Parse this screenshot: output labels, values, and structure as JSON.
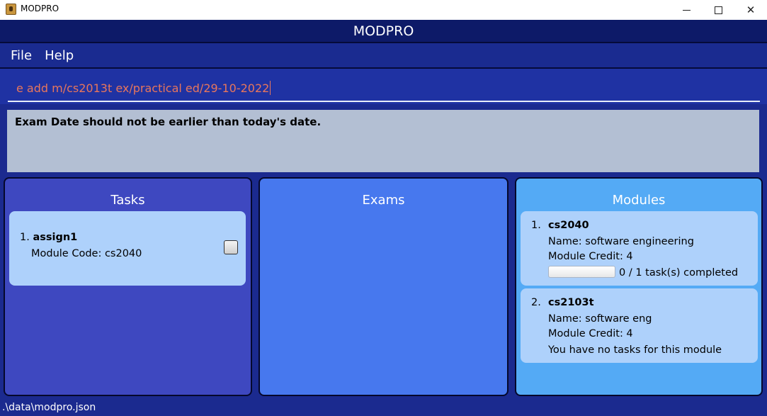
{
  "window": {
    "title": "MODPRO",
    "minimize_label": "",
    "maximize_label": "",
    "close_label": "✕"
  },
  "header": {
    "title": "MODPRO"
  },
  "menu": {
    "items": [
      "File",
      "Help"
    ]
  },
  "command": {
    "value": "e add m/cs2013t ex/practical ed/29-10-2022"
  },
  "result": {
    "message": "Exam Date should not be earlier than today's date."
  },
  "tasks": {
    "title": "Tasks",
    "items": [
      {
        "index": "1.",
        "name": "assign1",
        "module": "Module Code: cs2040",
        "done": false
      }
    ]
  },
  "exams": {
    "title": "Exams",
    "items": []
  },
  "modules": {
    "title": "Modules",
    "items": [
      {
        "index": "1.",
        "code": "cs2040",
        "name": "Name: software engineering",
        "credit": "Module Credit: 4",
        "progress": 0,
        "progress_text": "0 / 1 task(s) completed"
      },
      {
        "index": "2.",
        "code": "cs2103t",
        "name": "Name: software eng",
        "credit": "Module Credit: 4",
        "no_tasks_text": "You have no tasks for this module"
      }
    ]
  },
  "status": {
    "path": ".\\data\\modpro.json"
  },
  "colors": {
    "background": "#1b2a8f",
    "header": "#0d1a68",
    "command_text": "#e8765c",
    "result_bg": "#b3bfd3",
    "tasks_panel": "#3e48c0",
    "exams_panel": "#4778ee",
    "modules_panel": "#54aaf5",
    "card": "#aed1fb"
  }
}
